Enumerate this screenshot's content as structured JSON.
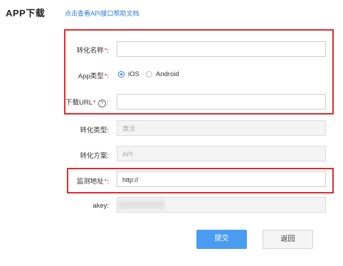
{
  "page": {
    "title": "APP下载",
    "help_link": "点击查看API接口帮助文档"
  },
  "form": {
    "conversion_name": {
      "label": "转化名称",
      "required": "*",
      "colon": ":",
      "value": ""
    },
    "app_type": {
      "label": "App类型",
      "required": "*",
      "colon": ":",
      "options": [
        "iOS",
        "Android"
      ],
      "selected": "iOS"
    },
    "download_url": {
      "label": "下载URL",
      "required": "*",
      "help_icon": "?",
      "colon": ":",
      "value": ""
    },
    "conversion_type": {
      "label": "转化类型",
      "colon": ":",
      "value": "激活"
    },
    "conversion_plan": {
      "label": "转化方案",
      "colon": ":",
      "value": "API"
    },
    "monitor_url": {
      "label": "监测地址",
      "required": "*",
      "colon": ":",
      "value": "http://"
    },
    "akey": {
      "label": "akey",
      "colon": ":"
    }
  },
  "buttons": {
    "submit": "提交",
    "back": "返回"
  },
  "colors": {
    "required": "#e02b2b",
    "accent": "#2d7ad6",
    "primary_button": "#4a9cf0",
    "highlight_box": "#e02b2b"
  },
  "icons": {
    "radio_checked": "radio-checked-icon",
    "radio_unchecked": "radio-unchecked-icon",
    "help": "question-circle-icon"
  }
}
